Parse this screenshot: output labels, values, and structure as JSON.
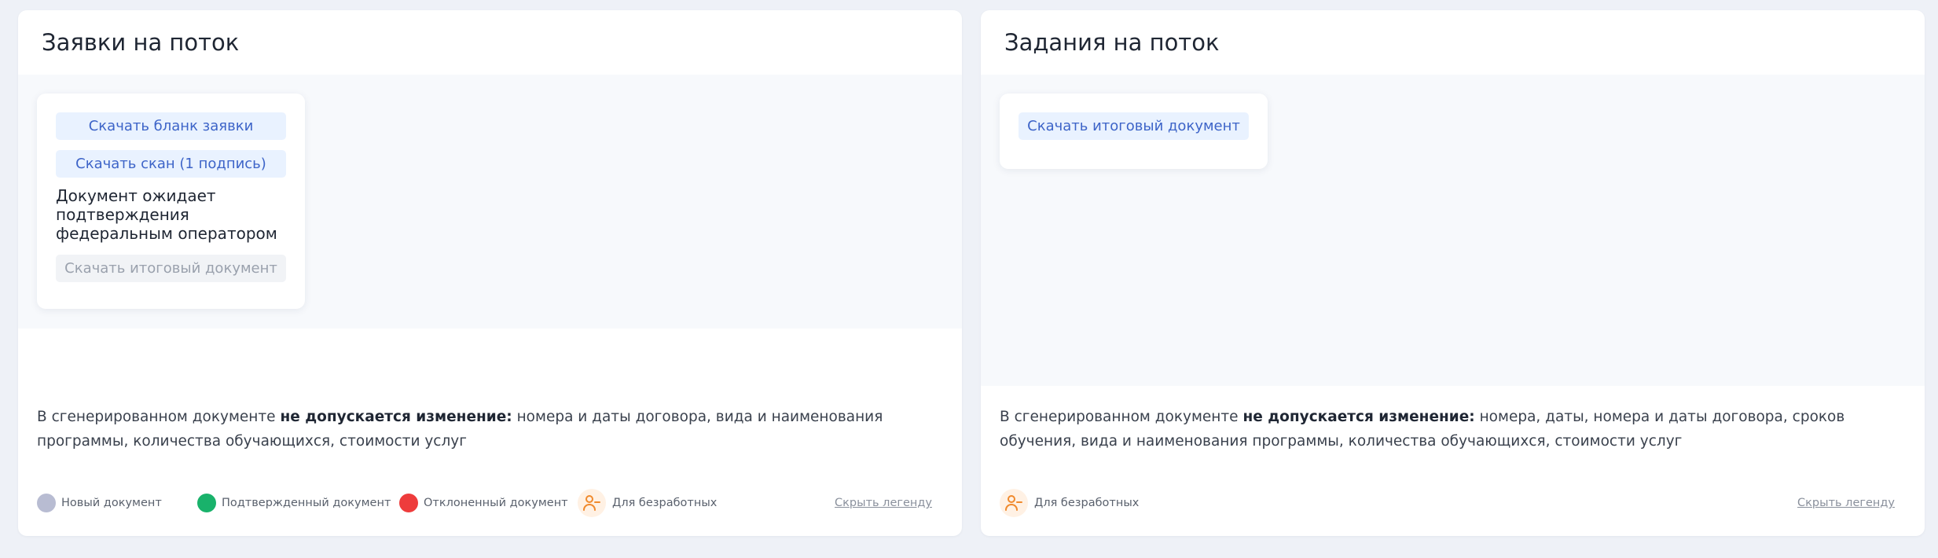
{
  "left_panel": {
    "title": "Заявки на поток",
    "buttons": {
      "download_form": "Скачать бланк заявки",
      "download_scan": "Скачать скан (1 подпись)",
      "download_final": "Скачать итоговый документ"
    },
    "status_text": "Документ ожидает подтверждения федеральным оператором",
    "note": {
      "prefix": "В сгенерированном документе ",
      "bold": "не допускается изменение:",
      "suffix": " номера и даты договора, вида и наименования программы, количества обучающихся, стоимости услуг"
    },
    "legend": {
      "items": [
        {
          "label": "Новый документ",
          "color": "#b8bcd2",
          "icon": "gray-dot-icon"
        },
        {
          "label": "Подтвержденный документ",
          "color": "#19b26b",
          "icon": "green-dot-icon"
        },
        {
          "label": "Отклоненный документ",
          "color": "#ee3c3c",
          "icon": "red-dot-icon"
        },
        {
          "label": "Для безработных",
          "color": "#f08a2d",
          "icon": "unemployed-person-icon"
        }
      ],
      "hide_label": "Скрыть легенду"
    }
  },
  "right_panel": {
    "title": "Задания на поток",
    "buttons": {
      "download_final": "Скачать итоговый документ"
    },
    "note": {
      "prefix": "В сгенерированном документе ",
      "bold": "не допускается изменение:",
      "suffix": " номера, даты, номера и даты договора, сроков обучения, вида и наименования программы, количества обучающихся, стоимости услуг"
    },
    "legend": {
      "items": [
        {
          "label": "Для безработных",
          "color": "#f08a2d",
          "icon": "unemployed-person-icon"
        }
      ],
      "hide_label": "Скрыть легенду"
    }
  }
}
